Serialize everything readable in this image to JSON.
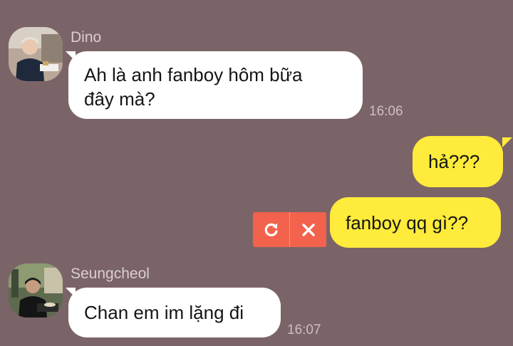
{
  "chat": {
    "messages": [
      {
        "sender": "Dino",
        "direction": "incoming",
        "lines": [
          "Ah là anh fanboy hôm bữa",
          "đây mà?"
        ],
        "time": "16:06"
      },
      {
        "sender": "me",
        "direction": "outgoing",
        "text": "hả???"
      },
      {
        "sender": "me",
        "direction": "outgoing",
        "text": "fanboy qq gì??",
        "status": "failed",
        "actions": [
          {
            "name": "resend",
            "icon": "refresh-icon"
          },
          {
            "name": "delete",
            "icon": "close-icon"
          }
        ]
      },
      {
        "sender": "Seungcheol",
        "direction": "incoming",
        "text": "Chan em im lặng đi",
        "time": "16:07"
      }
    ]
  },
  "colors": {
    "background": "#7b6468",
    "incoming_bubble": "#ffffff",
    "outgoing_bubble": "#ffeb3b",
    "failed_action": "#f2624c"
  }
}
